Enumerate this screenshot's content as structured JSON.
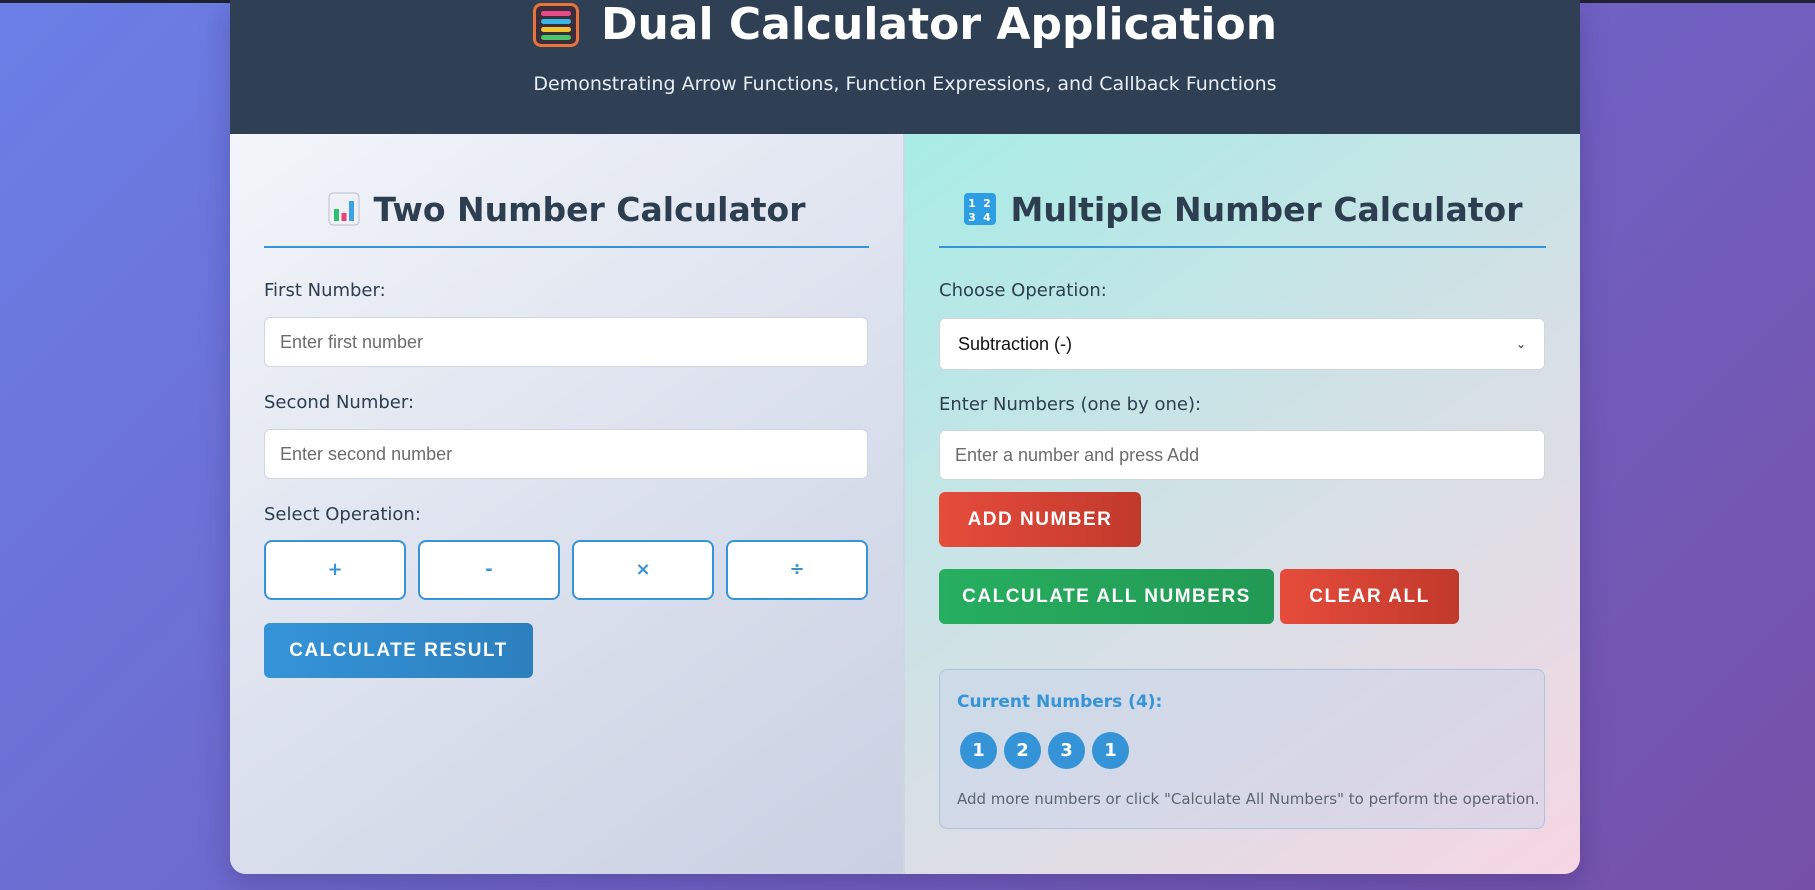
{
  "header": {
    "title": "Dual Calculator Application",
    "subtitle": "Demonstrating Arrow Functions, Function Expressions, and Callback Functions",
    "icon": "abacus-icon"
  },
  "two_calc": {
    "title": "Two Number Calculator",
    "icon": "bar-chart-icon",
    "first_label": "First Number:",
    "first_placeholder": "Enter first number",
    "first_value": "",
    "second_label": "Second Number:",
    "second_placeholder": "Enter second number",
    "second_value": "",
    "operation_label": "Select Operation:",
    "operations": [
      "+",
      "-",
      "×",
      "÷"
    ],
    "calculate_label": "Calculate Result"
  },
  "multi_calc": {
    "title": "Multiple Number Calculator",
    "icon": "numbers-icon",
    "choose_label": "Choose Operation:",
    "selected_operation": "Subtraction (-)",
    "enter_label": "Enter Numbers (one by one):",
    "number_placeholder": "Enter a number and press Add",
    "add_label": "Add Number",
    "calculate_all_label": "Calculate All Numbers",
    "clear_label": "Clear All",
    "current_title": "Current Numbers (4):",
    "numbers": [
      "1",
      "2",
      "3",
      "1"
    ],
    "hint": "Add more numbers or click \"Calculate All Numbers\" to perform the operation."
  },
  "colors": {
    "accent_blue": "#3594d8",
    "danger_red": "#e74c3c",
    "success_green": "#27ae60",
    "header_bg": "#2f4055"
  }
}
